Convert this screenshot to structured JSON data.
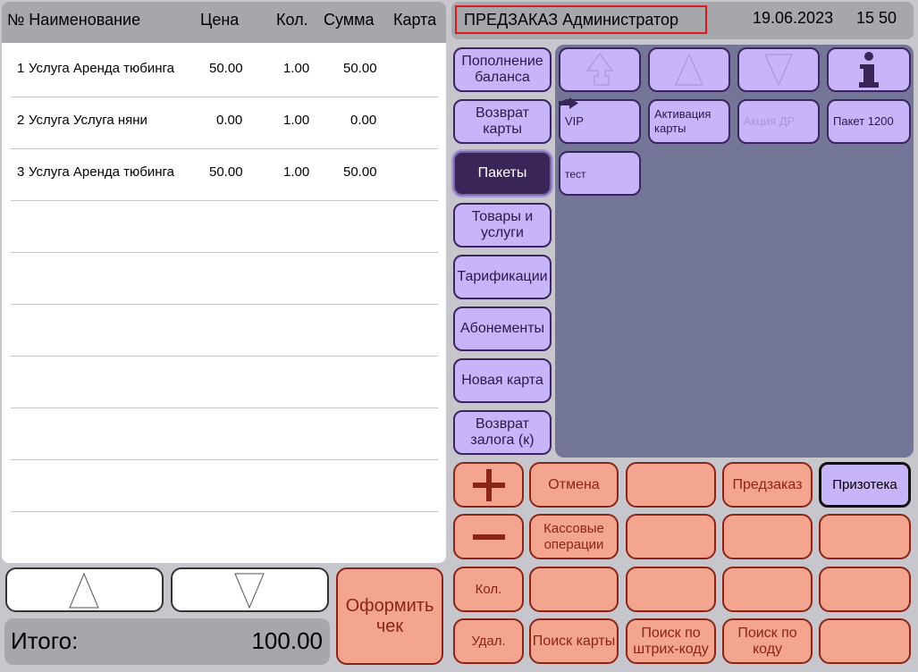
{
  "receipt": {
    "headers": {
      "num_name": "№ Наименование",
      "price": "Цена",
      "qty": "Кол.",
      "sum": "Сумма",
      "card": "Карта"
    },
    "rows": [
      {
        "n": "1",
        "name": "Услуга Аренда тюбинга",
        "price": "50.00",
        "qty": "1.00",
        "sum": "50.00"
      },
      {
        "n": "2",
        "name": "Услуга Услуга няни",
        "price": "0.00",
        "qty": "1.00",
        "sum": "0.00"
      },
      {
        "n": "3",
        "name": "Услуга Аренда тюбинга",
        "price": "50.00",
        "qty": "1.00",
        "sum": "50.00"
      }
    ]
  },
  "total": {
    "label": "Итого:",
    "value": "100.00"
  },
  "checkout_label": "Оформить чек",
  "header": {
    "title": "ПРЕДЗАКАЗ Администратор",
    "date": "19.06.2023",
    "time": "15 50"
  },
  "categories": [
    {
      "label": "Пополнение баланса"
    },
    {
      "label": "Возврат карты"
    },
    {
      "label": "Пакеты"
    },
    {
      "label": "Товары и услуги"
    },
    {
      "label": "Тарификации"
    },
    {
      "label": "Абонементы"
    },
    {
      "label": "Новая карта"
    },
    {
      "label": "Возврат залога (к)"
    }
  ],
  "packages": {
    "vip": "VIP",
    "activation": "Активация карты",
    "promo": "Акция ДР",
    "pack1200": "Пакет 1200",
    "test": "тест"
  },
  "actions": {
    "cancel": "Отмена",
    "preorder": "Предзаказ",
    "prizoteka": "Призотека",
    "cash_ops": "Кассовые операции",
    "qty": "Кол.",
    "delete": "Удал.",
    "find_card": "Поиск карты",
    "find_barcode": "Поиск по штрих-коду",
    "find_code": "Поиск по коду"
  },
  "colors": {
    "accent_salmon": "#f4a58f",
    "accent_lilac": "#c8b4f8",
    "selected": "#3a2558",
    "grid_bg": "#737696",
    "title_border": "#e01818"
  }
}
